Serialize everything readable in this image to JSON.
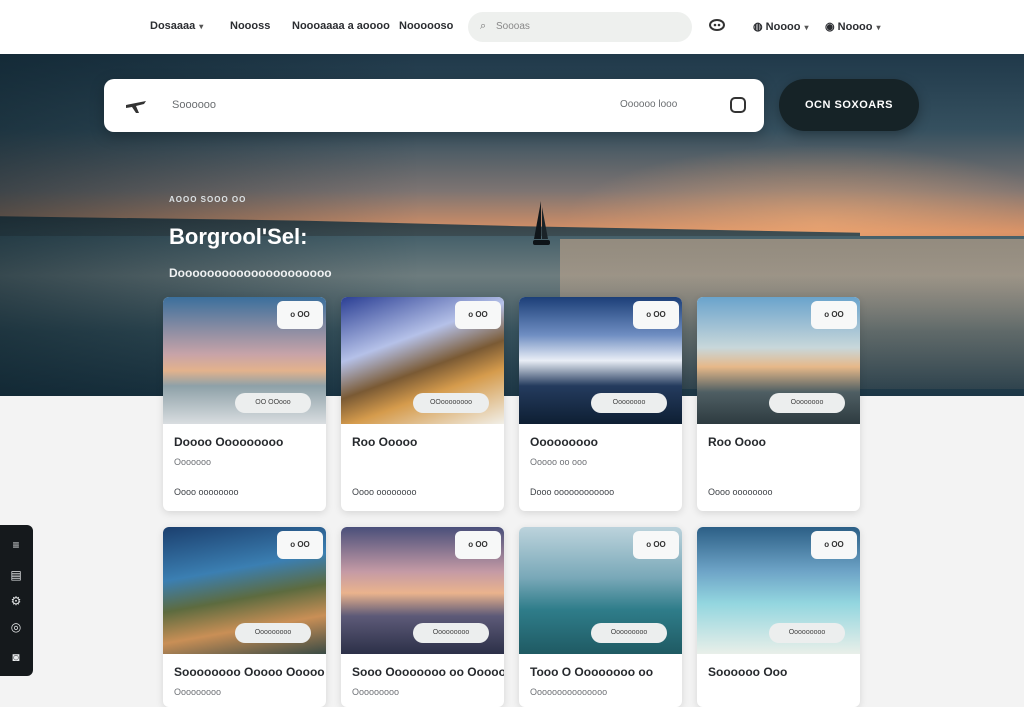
{
  "nav": {
    "items": [
      {
        "label": "Dosaaaa",
        "has_menu": true
      },
      {
        "label": "Noooss",
        "has_menu": false
      },
      {
        "label": "Noooaaaa a aoooo",
        "has_menu": false
      },
      {
        "label": "Noooooso",
        "has_menu": false
      }
    ],
    "search_placeholder": "Soooas",
    "search_icon": "search-icon",
    "icon": "chat-icon",
    "right_items": [
      {
        "label": "Noooo",
        "icon": "globe-icon"
      },
      {
        "label": "Noooo",
        "icon": "user-icon"
      }
    ]
  },
  "hero": {
    "search_placeholder": "Soooooo",
    "search_meta": "Oooooo  looo",
    "cta_label": "OCN SOXOARS",
    "kicker": "AOOO SOOO OO",
    "title": "Borgrool'Sel:",
    "subtitle": "Dooooooooooooooooooooo"
  },
  "cards": [
    {
      "badge": "o OO",
      "pill": "OO OOooo",
      "title": "Doooo Ooooooooo",
      "subtitle": "Ooooooo",
      "footer": "Oooo oooooooo"
    },
    {
      "badge": "o OO",
      "pill": "OOoooooooo",
      "title": "Roo Ooooo",
      "subtitle": "",
      "footer": "Oooo oooooooo"
    },
    {
      "badge": "o OO",
      "pill": "Oooooooo",
      "title": "Ooooooooo",
      "subtitle": "Ooooo oo ooo",
      "footer": "Dooo oooooooooooo"
    },
    {
      "badge": "o OO",
      "pill": "Oooooooo",
      "title": "Roo Oooo",
      "subtitle": "",
      "footer": "Oooo oooooooo"
    },
    {
      "badge": "o OO",
      "pill": "Ooooooooo",
      "title": "Soooooooo Ooooo Ooooo",
      "subtitle": "Ooooooooo",
      "footer": ""
    },
    {
      "badge": "o OO",
      "pill": "Ooooooooo",
      "title": "Sooo Oooooooo oo Ooooo",
      "subtitle": "Ooooooooo",
      "footer": ""
    },
    {
      "badge": "o OO",
      "pill": "Ooooooooo",
      "title": "Tooo O Oooooooo oo",
      "subtitle": "Ooooooooooooooo",
      "footer": ""
    },
    {
      "badge": "o OO",
      "pill": "Ooooooooo",
      "title": "Soooooo Ooo",
      "subtitle": "",
      "footer": ""
    }
  ],
  "sidebar": {
    "icons": [
      "menu-icon",
      "list-icon",
      "settings-icon",
      "help-icon",
      "chat-icon"
    ]
  },
  "colors": {
    "cta_bg": "#162327",
    "sidebar_bg": "#15191c",
    "card_bg": "#ffffff",
    "page_bg": "#f3f3f3"
  }
}
